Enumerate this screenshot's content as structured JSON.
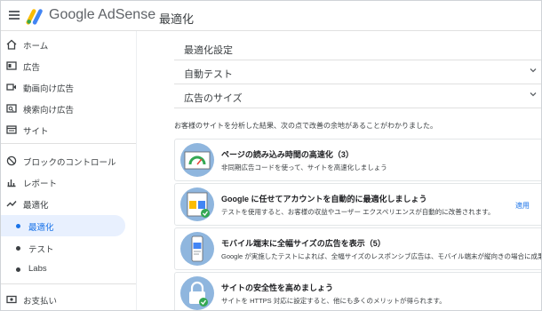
{
  "header": {
    "brand": "Google AdSense",
    "page_title": "最適化"
  },
  "sidebar": {
    "items": [
      {
        "label": "ホーム",
        "icon": "home-icon"
      },
      {
        "label": "広告",
        "icon": "ads-icon"
      },
      {
        "label": "動画向け広告",
        "icon": "video-icon"
      },
      {
        "label": "検索向け広告",
        "icon": "search-ads-icon"
      },
      {
        "label": "サイト",
        "icon": "sites-icon"
      },
      {
        "label": "ブロックのコントロール",
        "icon": "block-icon"
      },
      {
        "label": "レポート",
        "icon": "reports-icon"
      },
      {
        "label": "最適化",
        "icon": "optimization-icon"
      }
    ],
    "sub_items": [
      {
        "label": "最適化",
        "active": true
      },
      {
        "label": "テスト",
        "active": false
      },
      {
        "label": "Labs",
        "active": false
      }
    ],
    "payments": {
      "label": "お支払い",
      "icon": "payments-icon"
    }
  },
  "panel": {
    "title": "最適化設定",
    "rows": [
      {
        "label": "自動テスト"
      },
      {
        "label": "広告のサイズ"
      }
    ]
  },
  "intro_text": "お客様のサイトを分析した結果、次の点で改善の余地があることがわかりました。",
  "cards": [
    {
      "title": "ページの読み込み時間の高速化（3）",
      "desc": "非同期広告コードを使って、サイトを高速化しましょう",
      "icon": "speedometer-icon"
    },
    {
      "title": "Google に任せてアカウントを自動的に最適化しましょう",
      "desc": "テストを使用すると、お客様の収益やユーザー エクスペリエンスが自動的に改善されます。",
      "apply": "適用",
      "icon": "auto-optimize-icon"
    },
    {
      "title": "モバイル端末に全幅サイズの広告を表示（5）",
      "desc": "Google が実施したテストによれば、全幅サイズのレスポンシブ広告は、モバイル端末が縦向きの場合に成果が向上します。",
      "icon": "mobile-icon"
    },
    {
      "title": "サイトの安全性を高めましょう",
      "desc": "サイトを HTTPS 対応に設定すると、他にも多くのメリットが得られます。",
      "icon": "lock-icon"
    }
  ]
}
